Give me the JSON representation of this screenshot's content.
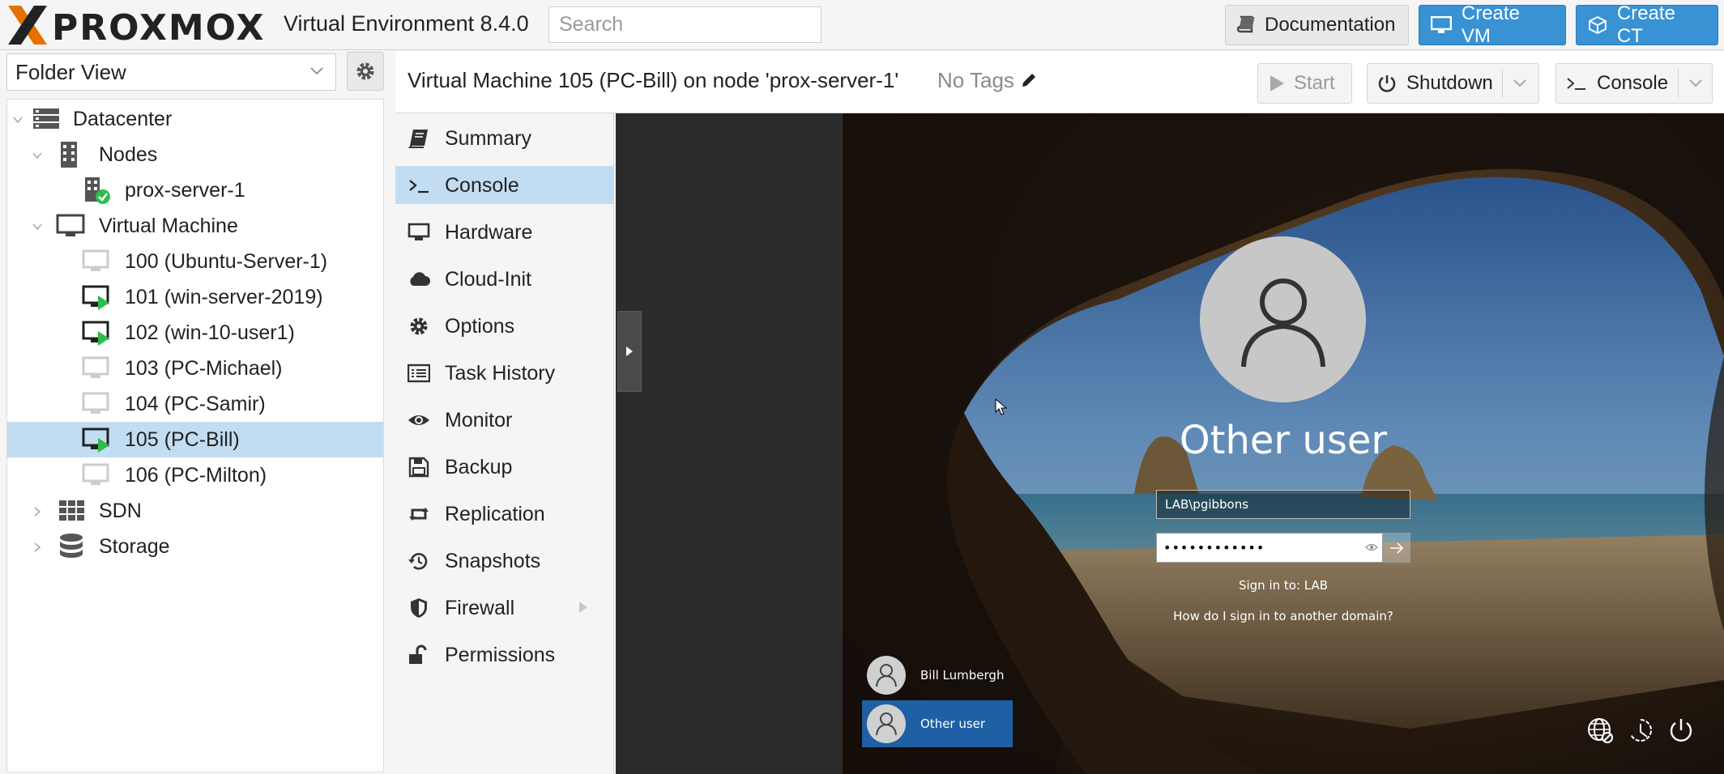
{
  "app": {
    "logo_text": "PROXMOX",
    "product_title": "Virtual Environment 8.4.0",
    "search_placeholder": "Search",
    "buttons": {
      "documentation": "Documentation",
      "create_vm": "Create VM",
      "create_ct": "Create CT"
    },
    "colors": {
      "accent": "#3892d4",
      "logo_orange": "#e57000",
      "selection": "#c2ddf2",
      "running_green": "#2ebd4a"
    }
  },
  "sidebar": {
    "view": "Folder View",
    "tree": {
      "datacenter": "Datacenter",
      "nodes": "Nodes",
      "node": "prox-server-1",
      "vm_folder": "Virtual Machine",
      "vms": [
        {
          "label": "100 (Ubuntu-Server-1)",
          "running": false
        },
        {
          "label": "101 (win-server-2019)",
          "running": true
        },
        {
          "label": "102 (win-10-user1)",
          "running": true
        },
        {
          "label": "103 (PC-Michael)",
          "running": false
        },
        {
          "label": "104 (PC-Samir)",
          "running": false
        },
        {
          "label": "105 (PC-Bill)",
          "running": true,
          "selected": true
        },
        {
          "label": "106 (PC-Milton)",
          "running": false
        }
      ],
      "sdn": "SDN",
      "storage": "Storage"
    }
  },
  "content": {
    "title": "Virtual Machine 105 (PC-Bill) on node 'prox-server-1'",
    "tags": "No Tags",
    "actions": {
      "start": "Start",
      "shutdown": "Shutdown",
      "console": "Console"
    }
  },
  "menu": {
    "items": [
      {
        "label": "Summary",
        "icon": "book-icon"
      },
      {
        "label": "Console",
        "icon": "terminal-icon",
        "active": true
      },
      {
        "label": "Hardware",
        "icon": "desktop-icon"
      },
      {
        "label": "Cloud-Init",
        "icon": "cloud-icon"
      },
      {
        "label": "Options",
        "icon": "gear-icon"
      },
      {
        "label": "Task History",
        "icon": "list-icon"
      },
      {
        "label": "Monitor",
        "icon": "eye-icon"
      },
      {
        "label": "Backup",
        "icon": "floppy-icon"
      },
      {
        "label": "Replication",
        "icon": "retweet-icon"
      },
      {
        "label": "Snapshots",
        "icon": "history-icon"
      },
      {
        "label": "Firewall",
        "icon": "shield-icon",
        "expandable": true
      },
      {
        "label": "Permissions",
        "icon": "unlock-icon"
      }
    ]
  },
  "guest_screen": {
    "title": "Other user",
    "username": "LAB\\pgibbons",
    "password_mask": "••••••••••••",
    "signin_to": "Sign in to: LAB",
    "other_domain": "How do I sign in to another domain?",
    "users": [
      {
        "name": "Bill Lumbergh",
        "active": false
      },
      {
        "name": "Other user",
        "active": true
      }
    ]
  }
}
